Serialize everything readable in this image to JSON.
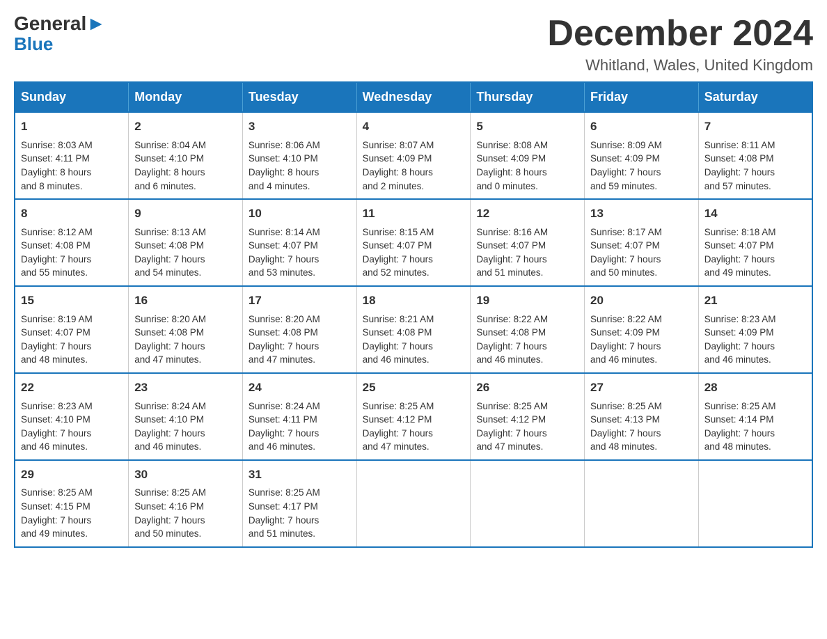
{
  "logo": {
    "part1": "General",
    "part2": "Blue"
  },
  "header": {
    "title": "December 2024",
    "subtitle": "Whitland, Wales, United Kingdom"
  },
  "weekdays": [
    "Sunday",
    "Monday",
    "Tuesday",
    "Wednesday",
    "Thursday",
    "Friday",
    "Saturday"
  ],
  "weeks": [
    [
      {
        "day": "1",
        "info": "Sunrise: 8:03 AM\nSunset: 4:11 PM\nDaylight: 8 hours\nand 8 minutes."
      },
      {
        "day": "2",
        "info": "Sunrise: 8:04 AM\nSunset: 4:10 PM\nDaylight: 8 hours\nand 6 minutes."
      },
      {
        "day": "3",
        "info": "Sunrise: 8:06 AM\nSunset: 4:10 PM\nDaylight: 8 hours\nand 4 minutes."
      },
      {
        "day": "4",
        "info": "Sunrise: 8:07 AM\nSunset: 4:09 PM\nDaylight: 8 hours\nand 2 minutes."
      },
      {
        "day": "5",
        "info": "Sunrise: 8:08 AM\nSunset: 4:09 PM\nDaylight: 8 hours\nand 0 minutes."
      },
      {
        "day": "6",
        "info": "Sunrise: 8:09 AM\nSunset: 4:09 PM\nDaylight: 7 hours\nand 59 minutes."
      },
      {
        "day": "7",
        "info": "Sunrise: 8:11 AM\nSunset: 4:08 PM\nDaylight: 7 hours\nand 57 minutes."
      }
    ],
    [
      {
        "day": "8",
        "info": "Sunrise: 8:12 AM\nSunset: 4:08 PM\nDaylight: 7 hours\nand 55 minutes."
      },
      {
        "day": "9",
        "info": "Sunrise: 8:13 AM\nSunset: 4:08 PM\nDaylight: 7 hours\nand 54 minutes."
      },
      {
        "day": "10",
        "info": "Sunrise: 8:14 AM\nSunset: 4:07 PM\nDaylight: 7 hours\nand 53 minutes."
      },
      {
        "day": "11",
        "info": "Sunrise: 8:15 AM\nSunset: 4:07 PM\nDaylight: 7 hours\nand 52 minutes."
      },
      {
        "day": "12",
        "info": "Sunrise: 8:16 AM\nSunset: 4:07 PM\nDaylight: 7 hours\nand 51 minutes."
      },
      {
        "day": "13",
        "info": "Sunrise: 8:17 AM\nSunset: 4:07 PM\nDaylight: 7 hours\nand 50 minutes."
      },
      {
        "day": "14",
        "info": "Sunrise: 8:18 AM\nSunset: 4:07 PM\nDaylight: 7 hours\nand 49 minutes."
      }
    ],
    [
      {
        "day": "15",
        "info": "Sunrise: 8:19 AM\nSunset: 4:07 PM\nDaylight: 7 hours\nand 48 minutes."
      },
      {
        "day": "16",
        "info": "Sunrise: 8:20 AM\nSunset: 4:08 PM\nDaylight: 7 hours\nand 47 minutes."
      },
      {
        "day": "17",
        "info": "Sunrise: 8:20 AM\nSunset: 4:08 PM\nDaylight: 7 hours\nand 47 minutes."
      },
      {
        "day": "18",
        "info": "Sunrise: 8:21 AM\nSunset: 4:08 PM\nDaylight: 7 hours\nand 46 minutes."
      },
      {
        "day": "19",
        "info": "Sunrise: 8:22 AM\nSunset: 4:08 PM\nDaylight: 7 hours\nand 46 minutes."
      },
      {
        "day": "20",
        "info": "Sunrise: 8:22 AM\nSunset: 4:09 PM\nDaylight: 7 hours\nand 46 minutes."
      },
      {
        "day": "21",
        "info": "Sunrise: 8:23 AM\nSunset: 4:09 PM\nDaylight: 7 hours\nand 46 minutes."
      }
    ],
    [
      {
        "day": "22",
        "info": "Sunrise: 8:23 AM\nSunset: 4:10 PM\nDaylight: 7 hours\nand 46 minutes."
      },
      {
        "day": "23",
        "info": "Sunrise: 8:24 AM\nSunset: 4:10 PM\nDaylight: 7 hours\nand 46 minutes."
      },
      {
        "day": "24",
        "info": "Sunrise: 8:24 AM\nSunset: 4:11 PM\nDaylight: 7 hours\nand 46 minutes."
      },
      {
        "day": "25",
        "info": "Sunrise: 8:25 AM\nSunset: 4:12 PM\nDaylight: 7 hours\nand 47 minutes."
      },
      {
        "day": "26",
        "info": "Sunrise: 8:25 AM\nSunset: 4:12 PM\nDaylight: 7 hours\nand 47 minutes."
      },
      {
        "day": "27",
        "info": "Sunrise: 8:25 AM\nSunset: 4:13 PM\nDaylight: 7 hours\nand 48 minutes."
      },
      {
        "day": "28",
        "info": "Sunrise: 8:25 AM\nSunset: 4:14 PM\nDaylight: 7 hours\nand 48 minutes."
      }
    ],
    [
      {
        "day": "29",
        "info": "Sunrise: 8:25 AM\nSunset: 4:15 PM\nDaylight: 7 hours\nand 49 minutes."
      },
      {
        "day": "30",
        "info": "Sunrise: 8:25 AM\nSunset: 4:16 PM\nDaylight: 7 hours\nand 50 minutes."
      },
      {
        "day": "31",
        "info": "Sunrise: 8:25 AM\nSunset: 4:17 PM\nDaylight: 7 hours\nand 51 minutes."
      },
      null,
      null,
      null,
      null
    ]
  ]
}
